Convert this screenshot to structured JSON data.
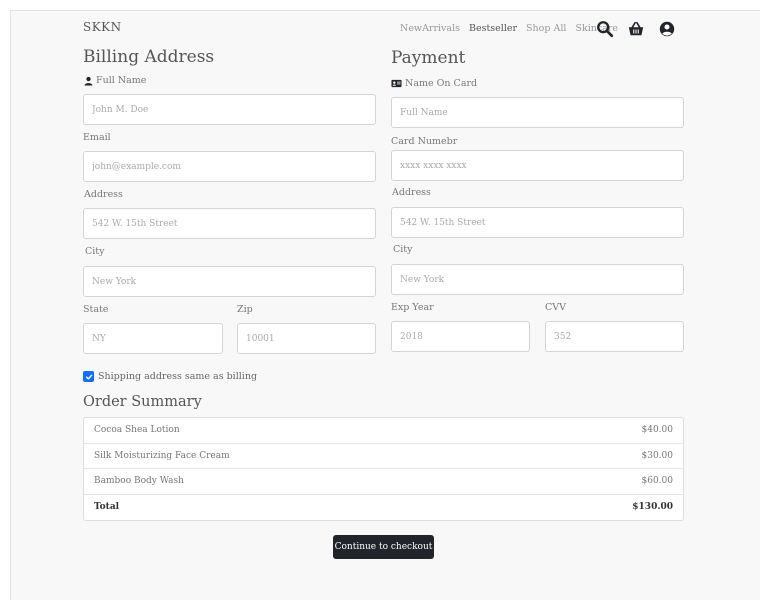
{
  "nav": {
    "brand": "SKKN",
    "links": [
      "NewArrivals",
      "Bestseller",
      "Shop All",
      "Skincare"
    ],
    "icons": [
      "search-icon",
      "basket-icon",
      "user-circle-icon"
    ]
  },
  "billing": {
    "title": "Billing Address",
    "full_name_label": "Full Name",
    "full_name_placeholder": "John M. Doe",
    "email_label": "Email",
    "email_placeholder": "john@example.com",
    "address_label": "Address",
    "address_placeholder": "542 W. 15th Street",
    "city_label": "City",
    "city_placeholder": "New York",
    "state_label": "State",
    "state_placeholder": "NY",
    "zip_label": "Zip",
    "zip_placeholder": "10001"
  },
  "payment": {
    "title": "Payment",
    "name_on_card_label": "Name On Card",
    "name_on_card_placeholder": "Full Name",
    "card_number_label": "Card Numebr",
    "card_number_placeholder": "xxxx xxxx xxxx",
    "address_label": "Address",
    "address_placeholder": "542 W. 15th Street",
    "city_label": "City",
    "city_placeholder": "New York",
    "exp_year_label": "Exp Year",
    "exp_year_placeholder": "2018",
    "cvv_label": "CVV",
    "cvv_placeholder": "352"
  },
  "shipping_same": {
    "label": "Shipping address same as billing",
    "checked": true
  },
  "order_summary": {
    "title": "Order Summary",
    "items": [
      {
        "name": "Cocoa Shea Lotion",
        "price": "$40.00"
      },
      {
        "name": "Silk Moisturizing Face Cream",
        "price": "$30.00"
      },
      {
        "name": "Bamboo Body Wash",
        "price": "$60.00"
      }
    ],
    "total_label": "Total",
    "total_value": "$130.00"
  },
  "checkout_button": "Continue to checkout",
  "colors": {
    "accent": "#0d6efd",
    "button": "#212529",
    "background": "#f8f8f8"
  }
}
